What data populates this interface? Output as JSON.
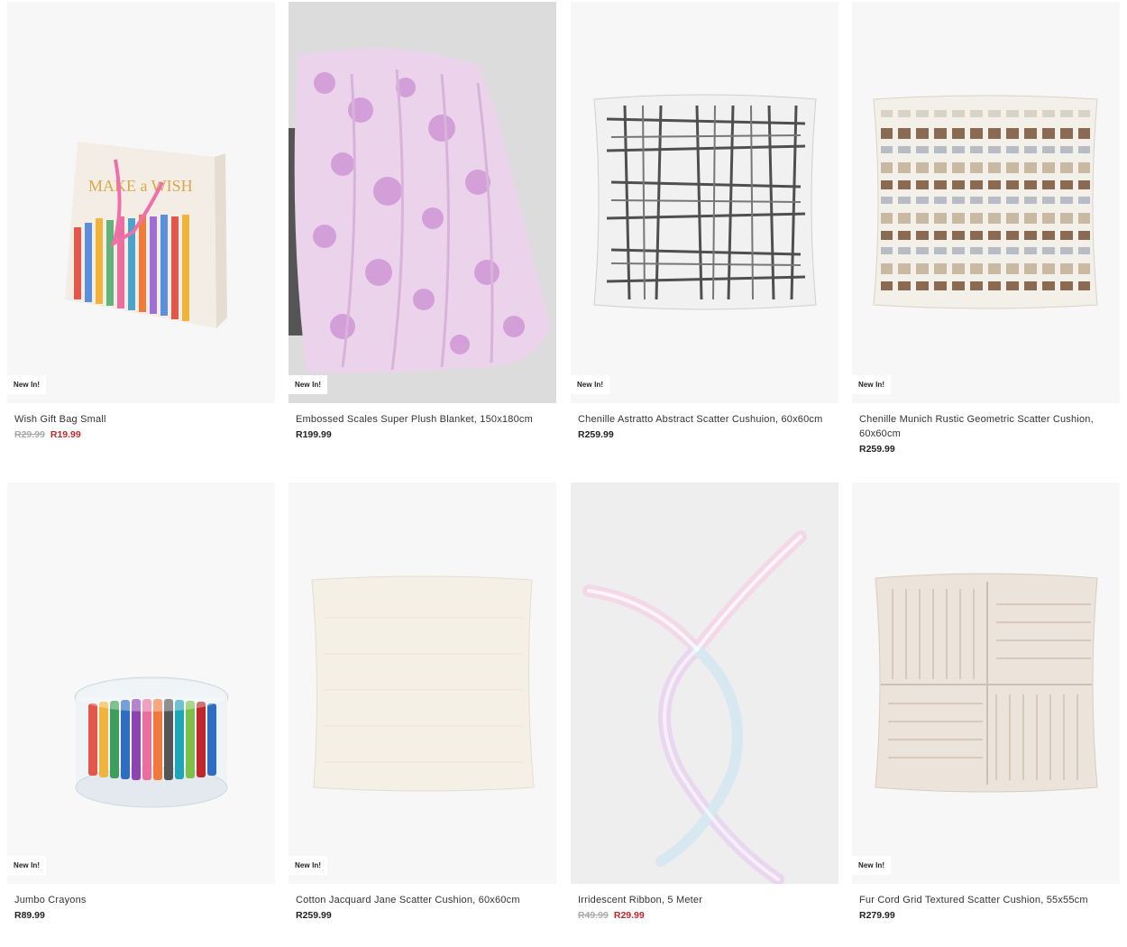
{
  "products": [
    {
      "badge": "New In!",
      "title": "Wish Gift Bag Small",
      "old_price": "R29.99",
      "price": "R19.99"
    },
    {
      "badge": "New In!",
      "title": "Embossed Scales Super Plush Blanket, 150x180cm",
      "price": "R199.99"
    },
    {
      "badge": "New In!",
      "title": "Chenille Astratto Abstract Scatter Cushuion, 60x60cm",
      "price": "R259.99"
    },
    {
      "badge": "New In!",
      "title": "Chenille Munich Rustic Geometric Scatter Cushion, 60x60cm",
      "price": "R259.99"
    },
    {
      "badge": "New In!",
      "title": "Jumbo Crayons",
      "price": "R89.99"
    },
    {
      "badge": "New In!",
      "title": "Cotton Jacquard Jane Scatter Cushion, 60x60cm",
      "price": "R259.99"
    },
    {
      "title": "Irridescent Ribbon, 5 Meter",
      "old_price": "R49.99",
      "price": "R29.99"
    },
    {
      "badge": "New In!",
      "title": "Fur Cord Grid Textured Scatter Cushion, 55x55cm",
      "price": "R279.99"
    }
  ],
  "colors": {
    "sale_price": "#c0272d",
    "old_price": "#aaaaaa",
    "image_bg": "#f7f7f7"
  }
}
